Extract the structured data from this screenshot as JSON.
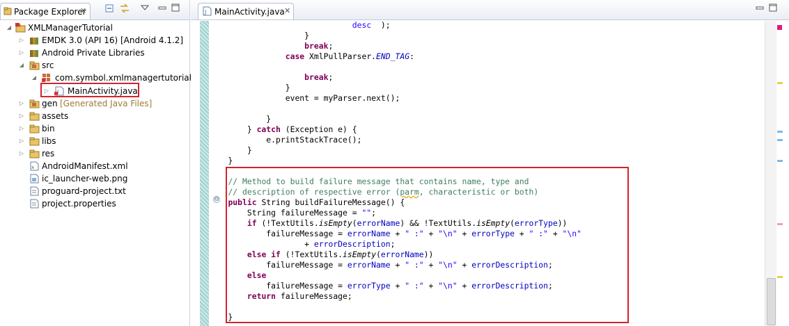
{
  "explorer": {
    "tab_title": "Package Explorer",
    "close_glyph": "✕",
    "toolbar_icons": [
      "collapse-all-icon",
      "link-with-editor-icon",
      "view-menu-icon",
      "minimize-icon",
      "maximize-icon"
    ],
    "tree": [
      {
        "label": "XMLManagerTutorial",
        "icon": "project-icon",
        "expanded": true
      },
      {
        "label": "EMDK 3.0 (API 16) [Android 4.1.2]",
        "icon": "library-icon",
        "expanded": false
      },
      {
        "label": "Android Private Libraries",
        "icon": "library-icon",
        "expanded": false
      },
      {
        "label": "src",
        "icon": "source-folder-icon",
        "expanded": true
      },
      {
        "label": "com.symbol.xmlmanagertutorial",
        "icon": "package-icon",
        "expanded": true
      },
      {
        "label": "MainActivity.java",
        "icon": "java-file-icon",
        "expanded": false,
        "highlighted": true
      },
      {
        "label": "gen",
        "hint": "[Generated Java Files]",
        "icon": "source-folder-icon",
        "expanded": false
      },
      {
        "label": "assets",
        "icon": "folder-icon",
        "expanded": false
      },
      {
        "label": "bin",
        "icon": "folder-icon",
        "expanded": false
      },
      {
        "label": "libs",
        "icon": "folder-icon",
        "expanded": false
      },
      {
        "label": "res",
        "icon": "folder-icon",
        "expanded": false
      },
      {
        "label": "AndroidManifest.xml",
        "icon": "xml-file-icon"
      },
      {
        "label": "ic_launcher-web.png",
        "icon": "image-file-icon"
      },
      {
        "label": "proguard-project.txt",
        "icon": "text-file-icon"
      },
      {
        "label": "project.properties",
        "icon": "text-file-icon"
      }
    ],
    "highlight_color": "#d3232c"
  },
  "editor": {
    "tab_title": "MainActivity.java",
    "close_glyph": "✕",
    "code_lines": [
      [
        [
          "",
          "                              "
        ],
        [
          "st",
          "desc"
        ],
        [
          "",
          "  );"
        ]
      ],
      [
        [
          "",
          "                    }"
        ]
      ],
      [
        [
          "",
          "                    "
        ],
        [
          "kw",
          "break"
        ],
        [
          "",
          ";"
        ]
      ],
      [
        [
          "",
          "                "
        ],
        [
          "kw",
          "case"
        ],
        [
          "",
          " XmlPullParser."
        ],
        [
          "fd it",
          "END_TAG"
        ],
        [
          "",
          ":"
        ]
      ],
      [
        [
          "",
          ""
        ]
      ],
      [
        [
          "",
          "                    "
        ],
        [
          "kw",
          "break"
        ],
        [
          "",
          ";"
        ]
      ],
      [
        [
          "",
          "                }"
        ]
      ],
      [
        [
          "",
          "                event = myParser.next();"
        ]
      ],
      [
        [
          "",
          ""
        ]
      ],
      [
        [
          "",
          "            }"
        ]
      ],
      [
        [
          "",
          "        } "
        ],
        [
          "kw",
          "catch"
        ],
        [
          "",
          " (Exception e) {"
        ]
      ],
      [
        [
          "",
          "            e.printStackTrace();"
        ]
      ],
      [
        [
          "",
          "        }"
        ]
      ],
      [
        [
          "",
          "    }"
        ]
      ],
      [
        [
          "",
          ""
        ]
      ],
      [
        [
          "",
          "    "
        ],
        [
          "cm",
          "// Method to build failure message that contains name, type and"
        ]
      ],
      [
        [
          "",
          "    "
        ],
        [
          "cm",
          "// description of respective error ("
        ],
        [
          "cm sq",
          "parm"
        ],
        [
          "cm",
          ", characteristic or both)"
        ]
      ],
      [
        [
          "",
          "    "
        ],
        [
          "kw",
          "public"
        ],
        [
          "",
          " String buildFailureMessage() {"
        ]
      ],
      [
        [
          "",
          "        String failureMessage = "
        ],
        [
          "st",
          "\"\""
        ],
        [
          "",
          ";"
        ]
      ],
      [
        [
          "",
          "        "
        ],
        [
          "kw",
          "if"
        ],
        [
          "",
          " (!TextUtils."
        ],
        [
          "it",
          "isEmpty"
        ],
        [
          "",
          "("
        ],
        [
          "fd",
          "errorName"
        ],
        [
          "",
          ") && !TextUtils."
        ],
        [
          "it",
          "isEmpty"
        ],
        [
          "",
          "("
        ],
        [
          "fd",
          "errorType"
        ],
        [
          "",
          "))"
        ]
      ],
      [
        [
          "",
          "            failureMessage = "
        ],
        [
          "fd",
          "errorName"
        ],
        [
          "",
          " + "
        ],
        [
          "st",
          "\" :\""
        ],
        [
          "",
          " + "
        ],
        [
          "st",
          "\"\\n\""
        ],
        [
          "",
          " + "
        ],
        [
          "fd",
          "errorType"
        ],
        [
          "",
          " + "
        ],
        [
          "st",
          "\" :\""
        ],
        [
          "",
          " + "
        ],
        [
          "st",
          "\"\\n\""
        ]
      ],
      [
        [
          "",
          "                    + "
        ],
        [
          "fd",
          "errorDescription"
        ],
        [
          "",
          ";"
        ]
      ],
      [
        [
          "",
          "        "
        ],
        [
          "kw",
          "else if"
        ],
        [
          "",
          " (!TextUtils."
        ],
        [
          "it",
          "isEmpty"
        ],
        [
          "",
          "("
        ],
        [
          "fd",
          "errorName"
        ],
        [
          "",
          "))"
        ]
      ],
      [
        [
          "",
          "            failureMessage = "
        ],
        [
          "fd",
          "errorName"
        ],
        [
          "",
          " + "
        ],
        [
          "st",
          "\" :\""
        ],
        [
          "",
          " + "
        ],
        [
          "st",
          "\"\\n\""
        ],
        [
          "",
          " + "
        ],
        [
          "fd",
          "errorDescription"
        ],
        [
          "",
          ";"
        ]
      ],
      [
        [
          "",
          "        "
        ],
        [
          "kw",
          "else"
        ]
      ],
      [
        [
          "",
          "            failureMessage = "
        ],
        [
          "fd",
          "errorType"
        ],
        [
          "",
          " + "
        ],
        [
          "st",
          "\" :\""
        ],
        [
          "",
          " + "
        ],
        [
          "st",
          "\"\\n\""
        ],
        [
          "",
          " + "
        ],
        [
          "fd",
          "errorDescription"
        ],
        [
          "",
          ";"
        ]
      ],
      [
        [
          "",
          "        "
        ],
        [
          "kw",
          "return"
        ],
        [
          "",
          " failureMessage;"
        ]
      ],
      [
        [
          "",
          ""
        ]
      ],
      [
        [
          "",
          "    }"
        ]
      ]
    ],
    "fold_glyph": "⊖",
    "highlight_color": "#d3232c"
  }
}
